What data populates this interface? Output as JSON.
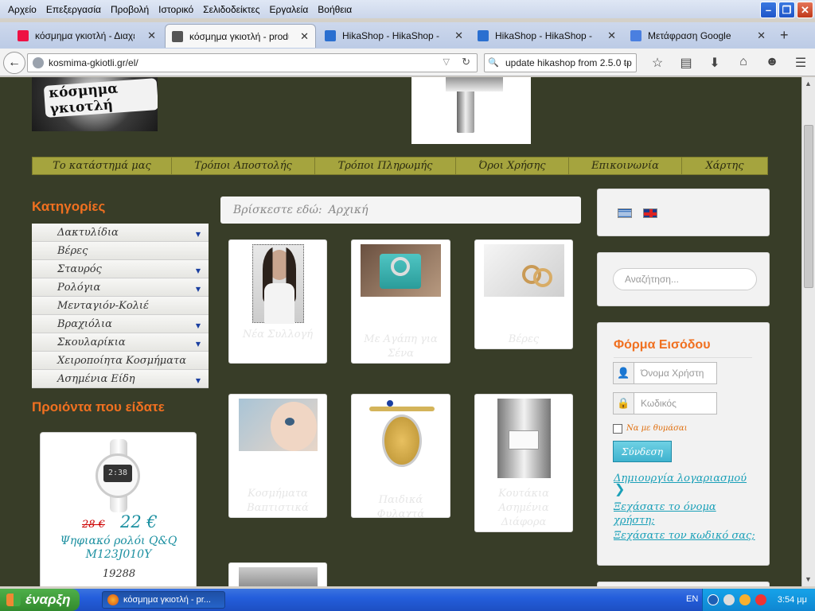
{
  "menubar": {
    "items": [
      "Αρχείο",
      "Επεξεργασία",
      "Προβολή",
      "Ιστορικό",
      "Σελιδοδείκτες",
      "Εργαλεία",
      "Βοήθεια"
    ]
  },
  "tabs": [
    {
      "label": "κόσμημα γκιοτλή - Διαχεί...",
      "icon_color": "#e14",
      "active": false
    },
    {
      "label": "κόσμημα γκιοτλή - produ...",
      "icon_color": "#555",
      "active": true
    },
    {
      "label": "HikaShop - HikaShop - To...",
      "icon_color": "#2a6fd0",
      "active": false
    },
    {
      "label": "HikaShop - HikaShop - Ne...",
      "icon_color": "#2a6fd0",
      "active": false
    },
    {
      "label": "Μετάφραση Google",
      "icon_color": "#4a7fe0",
      "active": false
    }
  ],
  "navbar": {
    "url": "kosmima-gkiotli.gr/el/",
    "search_value": "update hikashop from 2.5.0 tp"
  },
  "logo_text": "κόσμημα γκιοτλή",
  "topnav": [
    "Το κατάστημά μας",
    "Τρόποι Αποστολής",
    "Τρόποι Πληρωμής",
    "Όροι Χρήσης",
    "Επικοινωνία",
    "Χάρτης"
  ],
  "categories_title": "Κατηγορίες",
  "categories": [
    {
      "label": "Δακτυλίδια",
      "sub": true
    },
    {
      "label": "Βέρες",
      "sub": false
    },
    {
      "label": "Σταυρός",
      "sub": true
    },
    {
      "label": "Ρολόγια",
      "sub": true
    },
    {
      "label": "Μενταγιόν-Κολιέ",
      "sub": false
    },
    {
      "label": "Βραχιόλια",
      "sub": true
    },
    {
      "label": "Σκουλαρίκια",
      "sub": true
    },
    {
      "label": "Χειροποίητα Κοσμήματα",
      "sub": false
    },
    {
      "label": "Ασημένια Είδη",
      "sub": true
    }
  ],
  "viewed_title": "Προιόντα που είδατε",
  "viewed_product": {
    "old_price": "28 €",
    "new_price": "22 €",
    "name": "Ψηφιακό ρολόι Q&Q M123J010Y",
    "code": "19288",
    "watch_screen": "2:38"
  },
  "breadcrumb": {
    "prefix": "Βρίσκεστε εδώ:",
    "current": "Αρχική"
  },
  "products": [
    {
      "label": "Νέα Συλλογή",
      "image_type": "woman"
    },
    {
      "label": "Με Αγάπη για Σένα",
      "image_type": "ring-box"
    },
    {
      "label": "Βέρες",
      "image_type": "wedding-rings"
    },
    {
      "label": "Κοσμήματα Βαπτιστικά",
      "image_type": "baby"
    },
    {
      "label": "Παιδικά Φυλαχτά",
      "image_type": "charm"
    },
    {
      "label": "Κουτάκια Ασημένια Διάφορα",
      "image_type": "silver-box"
    }
  ],
  "search": {
    "placeholder": "Αναζήτηση..."
  },
  "login": {
    "title": "Φόρμα Εισόδου",
    "username_placeholder": "Όνομα Χρήστη",
    "password_placeholder": "Κωδικός",
    "remember_label": "Να με θυμάσαι",
    "submit_label": "Σύνδεση",
    "create_account": "Δημιουργία λογαριασμού",
    "forgot_username": "Ξεχάσατε το όνομα χρήστη;",
    "forgot_password": "Ξεχάσατε τον κωδικό σας;"
  },
  "taskbar": {
    "start_label": "έναρξη",
    "window_label": "κόσμημα γκιοτλή - pr...",
    "language": "EN",
    "clock": "3:54 μμ"
  },
  "colors": {
    "page_bg": "#383d28",
    "accent_orange": "#f07020",
    "nav_olive": "#a5a43e",
    "link_teal": "#1aa0b8"
  }
}
